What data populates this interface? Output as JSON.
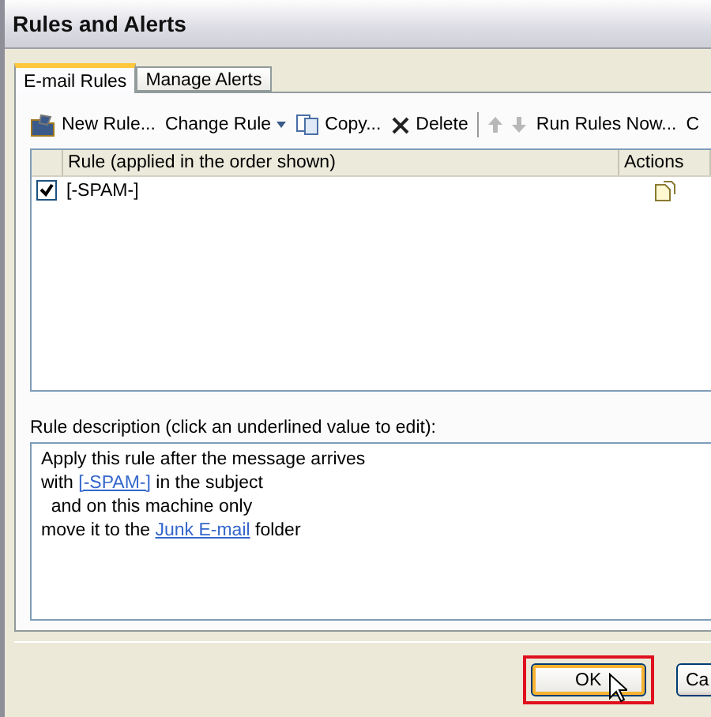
{
  "window": {
    "title": "Rules and Alerts"
  },
  "tabs": [
    {
      "label": "E-mail Rules",
      "selected": true
    },
    {
      "label": "Manage Alerts",
      "selected": false
    }
  ],
  "toolbar": [
    {
      "kind": "new",
      "label": "New Rule..."
    },
    {
      "kind": "dropdown",
      "label": "Change Rule"
    },
    {
      "kind": "copy",
      "label": "Copy..."
    },
    {
      "kind": "delete",
      "label": "Delete"
    },
    {
      "kind": "separator"
    },
    {
      "kind": "up",
      "disabled": true
    },
    {
      "kind": "down",
      "disabled": true
    },
    {
      "kind": "text",
      "label": "Run Rules Now..."
    },
    {
      "kind": "text",
      "label": "C"
    }
  ],
  "rules_table": {
    "columns": [
      "Rule (applied in the order shown)",
      "Actions"
    ],
    "rows": [
      {
        "checked": true,
        "rule": "[-SPAM-]",
        "selected": false
      }
    ]
  },
  "description": {
    "label": "Rule description (click an underlined value to edit):",
    "lines": [
      [
        {
          "text": "Apply this rule after the message arrives"
        }
      ],
      [
        {
          "text": "with "
        },
        {
          "text": "[-SPAM-]",
          "link": true
        },
        {
          "text": " in the subject"
        }
      ],
      [
        {
          "text": "  and on this machine only"
        }
      ],
      [
        {
          "text": "move it to the "
        },
        {
          "text": "Junk E-mail",
          "link": true
        },
        {
          "text": " folder"
        }
      ]
    ]
  },
  "buttons": [
    {
      "label": "OK",
      "highlighted": true
    },
    {
      "label": "Ca",
      "highlighted": false
    }
  ]
}
